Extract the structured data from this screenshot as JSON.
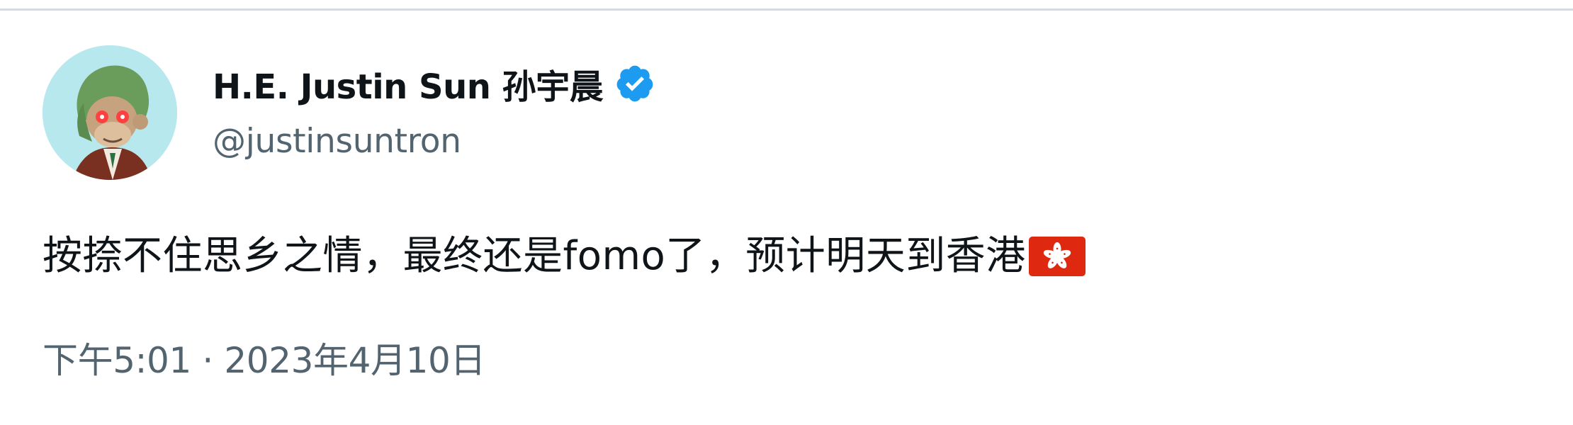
{
  "tweet": {
    "author": {
      "display_name": "H.E. Justin Sun 孙宇晨",
      "handle": "@justinsuntron",
      "verified": true,
      "avatar_icon": "ape-avatar-icon",
      "verified_icon": "verified-badge-icon"
    },
    "text": "按捺不住思乡之情，最终还是fomo了，预计明天到香港",
    "emoji": "hong-kong-flag-icon",
    "time": "下午5:01",
    "separator": "·",
    "date": "2023年4月10日"
  },
  "colors": {
    "text_primary": "#0f1419",
    "text_secondary": "#536471",
    "verified_blue": "#1d9bf0",
    "divider": "#d7dbdf",
    "avatar_bg": "#b7e8ee",
    "flag_red": "#de2910"
  }
}
